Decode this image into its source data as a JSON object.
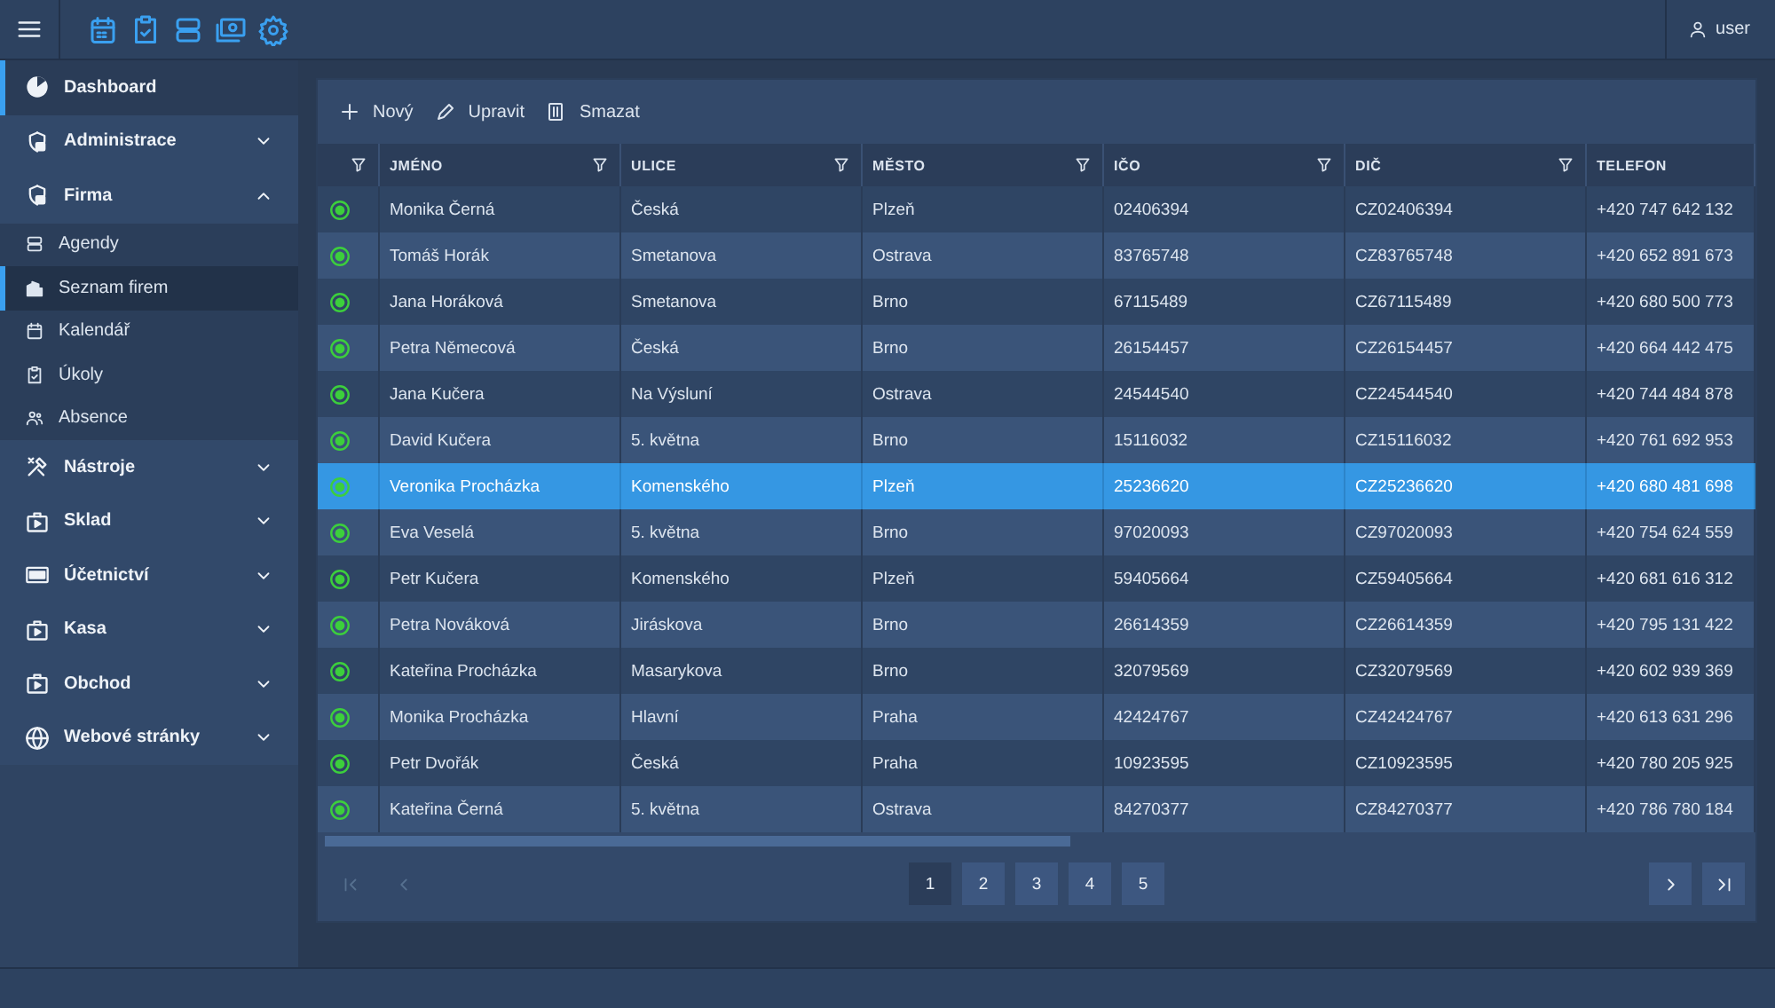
{
  "topbar": {
    "user": "user"
  },
  "sidebar": {
    "items": [
      {
        "kind": "link",
        "label": "Dashboard",
        "selected": true
      },
      {
        "kind": "group",
        "label": "Administrace",
        "expanded": false
      },
      {
        "kind": "group",
        "label": "Firma",
        "expanded": true,
        "children": [
          {
            "label": "Agendy",
            "selected": false
          },
          {
            "label": "Seznam firem",
            "selected": true
          },
          {
            "label": "Kalendář",
            "selected": false
          },
          {
            "label": "Úkoly",
            "selected": false
          },
          {
            "label": "Absence",
            "selected": false
          }
        ]
      },
      {
        "kind": "group",
        "label": "Nástroje",
        "expanded": false
      },
      {
        "kind": "group",
        "label": "Sklad",
        "expanded": false
      },
      {
        "kind": "group",
        "label": "Účetnictví",
        "expanded": false
      },
      {
        "kind": "group",
        "label": "Kasa",
        "expanded": false
      },
      {
        "kind": "group",
        "label": "Obchod",
        "expanded": false
      },
      {
        "kind": "group",
        "label": "Webové stránky",
        "expanded": false
      }
    ]
  },
  "toolbar": [
    {
      "kind": "new",
      "label": "Nový"
    },
    {
      "kind": "edit",
      "label": "Upravit"
    },
    {
      "kind": "delete",
      "label": "Smazat"
    }
  ],
  "table": {
    "status_column": {
      "filter": true
    },
    "columns": [
      {
        "label": "JMÉNO",
        "filter": true
      },
      {
        "label": "ULICE",
        "filter": true
      },
      {
        "label": "MĚSTO",
        "filter": true
      },
      {
        "label": "IČO",
        "filter": true
      },
      {
        "label": "DIČ",
        "filter": true
      },
      {
        "label": "TELEFON",
        "filter": false
      }
    ],
    "rows": [
      {
        "selected": false,
        "cells": [
          "Monika Černá",
          "Česká",
          "Plzeň",
          "02406394",
          "CZ02406394",
          "+420 747 642 132"
        ]
      },
      {
        "selected": false,
        "cells": [
          "Tomáš Horák",
          "Smetanova",
          "Ostrava",
          "83765748",
          "CZ83765748",
          "+420 652 891 673"
        ]
      },
      {
        "selected": false,
        "cells": [
          "Jana Horáková",
          "Smetanova",
          "Brno",
          "67115489",
          "CZ67115489",
          "+420 680 500 773"
        ]
      },
      {
        "selected": false,
        "cells": [
          "Petra Němecová",
          "Česká",
          "Brno",
          "26154457",
          "CZ26154457",
          "+420 664 442 475"
        ]
      },
      {
        "selected": false,
        "cells": [
          "Jana Kučera",
          "Na Výsluní",
          "Ostrava",
          "24544540",
          "CZ24544540",
          "+420 744 484 878"
        ]
      },
      {
        "selected": false,
        "cells": [
          "David Kučera",
          "5. května",
          "Brno",
          "15116032",
          "CZ15116032",
          "+420 761 692 953"
        ]
      },
      {
        "selected": true,
        "cells": [
          "Veronika Procházka",
          "Komenského",
          "Plzeň",
          "25236620",
          "CZ25236620",
          "+420 680 481 698"
        ]
      },
      {
        "selected": false,
        "cells": [
          "Eva Veselá",
          "5. května",
          "Brno",
          "97020093",
          "CZ97020093",
          "+420 754 624 559"
        ]
      },
      {
        "selected": false,
        "cells": [
          "Petr Kučera",
          "Komenského",
          "Plzeň",
          "59405664",
          "CZ59405664",
          "+420 681 616 312"
        ]
      },
      {
        "selected": false,
        "cells": [
          "Petra Nováková",
          "Jiráskova",
          "Brno",
          "26614359",
          "CZ26614359",
          "+420 795 131 422"
        ]
      },
      {
        "selected": false,
        "cells": [
          "Kateřina Procházka",
          "Masarykova",
          "Brno",
          "32079569",
          "CZ32079569",
          "+420 602 939 369"
        ]
      },
      {
        "selected": false,
        "cells": [
          "Monika Procházka",
          "Hlavní",
          "Praha",
          "42424767",
          "CZ42424767",
          "+420 613 631 296"
        ]
      },
      {
        "selected": false,
        "cells": [
          "Petr Dvořák",
          "Česká",
          "Praha",
          "10923595",
          "CZ10923595",
          "+420 780 205 925"
        ]
      },
      {
        "selected": false,
        "cells": [
          "Kateřina Černá",
          "5. května",
          "Ostrava",
          "84270377",
          "CZ84270377",
          "+420 786 780 184"
        ]
      }
    ]
  },
  "pagination": {
    "first_disabled": true,
    "prev_disabled": true,
    "next_disabled": false,
    "last_disabled": false,
    "pages": [
      {
        "label": "1",
        "selected": true
      },
      {
        "label": "2",
        "selected": false
      },
      {
        "label": "3",
        "selected": false
      },
      {
        "label": "4",
        "selected": false
      },
      {
        "label": "5",
        "selected": false
      }
    ]
  }
}
